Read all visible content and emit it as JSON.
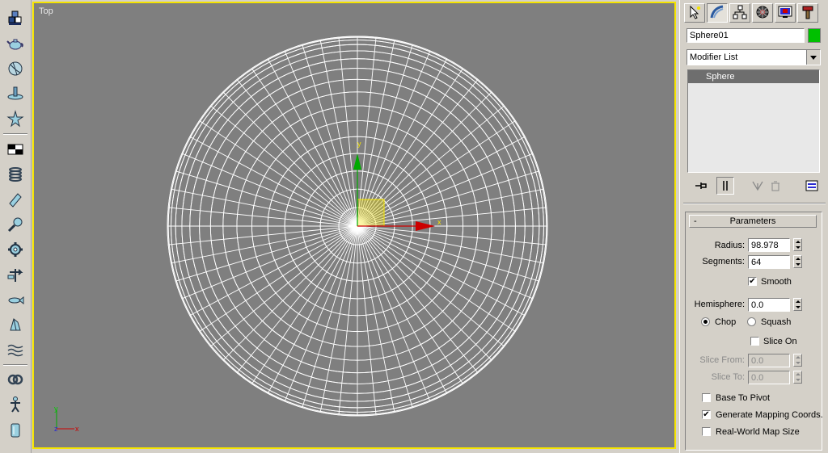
{
  "left_toolbar": {
    "tools": [
      {
        "icon": "box-stack-icon"
      },
      {
        "icon": "teapot-icon"
      },
      {
        "icon": "sphere-icon"
      },
      {
        "icon": "plane-icon"
      },
      {
        "icon": "star-icon"
      },
      {
        "icon": "checker-icon"
      },
      {
        "icon": "spring-icon"
      },
      {
        "icon": "cylinder-icon"
      },
      {
        "icon": "spotlight-icon"
      },
      {
        "icon": "gear-icon"
      },
      {
        "icon": "weathervane-icon"
      },
      {
        "icon": "fish-icon"
      },
      {
        "icon": "bone-icon"
      },
      {
        "icon": "wave-icon"
      },
      {
        "icon": "knot-icon"
      },
      {
        "icon": "biped-icon"
      },
      {
        "icon": "bottle-icon"
      }
    ]
  },
  "viewport": {
    "label": "Top",
    "gizmo": {
      "x_label": "x",
      "y_label": "y"
    },
    "corner_axes": {
      "x_label": "x",
      "y_label": "y",
      "z_label": "z"
    },
    "colors": {
      "background": "#7f7f7f",
      "border": "#f5e400",
      "wire": "#ffffff",
      "x_axis": "#cc0000",
      "y_axis": "#00aa00"
    }
  },
  "command_panel": {
    "tabs": [
      {
        "icon": "cursor-create-icon"
      },
      {
        "icon": "modify-curve-icon"
      },
      {
        "icon": "hierarchy-icon"
      },
      {
        "icon": "motion-wheel-icon"
      },
      {
        "icon": "display-monitor-icon"
      },
      {
        "icon": "utilities-hammer-icon"
      }
    ],
    "object_name": "Sphere01",
    "object_color": "#00c000",
    "modifier_list": "Modifier List",
    "stack_items": [
      "Sphere"
    ],
    "stack_buttons": [
      {
        "icon": "pin-icon"
      },
      {
        "icon": "show-end-result-icon"
      },
      {
        "icon": "make-unique-icon"
      },
      {
        "icon": "remove-modifier-icon"
      },
      {
        "icon": "configure-sets-icon"
      }
    ],
    "parameters": {
      "title": "Parameters",
      "collapse": "-",
      "radius_label": "Radius:",
      "radius": "98.978",
      "segments_label": "Segments:",
      "segments": "64",
      "smooth_label": "Smooth",
      "smooth_checked": "✔",
      "hemisphere_label": "Hemisphere:",
      "hemisphere": "0.0",
      "chop_label": "Chop",
      "squash_label": "Squash",
      "slice_on_label": "Slice On",
      "slice_from_label": "Slice From:",
      "slice_from": "0.0",
      "slice_to_label": "Slice To:",
      "slice_to": "0.0",
      "base_to_pivot_label": "Base To Pivot",
      "gen_mapping_label": "Generate Mapping Coords.",
      "gen_mapping_checked": "✔",
      "real_world_label": "Real-World Map Size"
    }
  }
}
